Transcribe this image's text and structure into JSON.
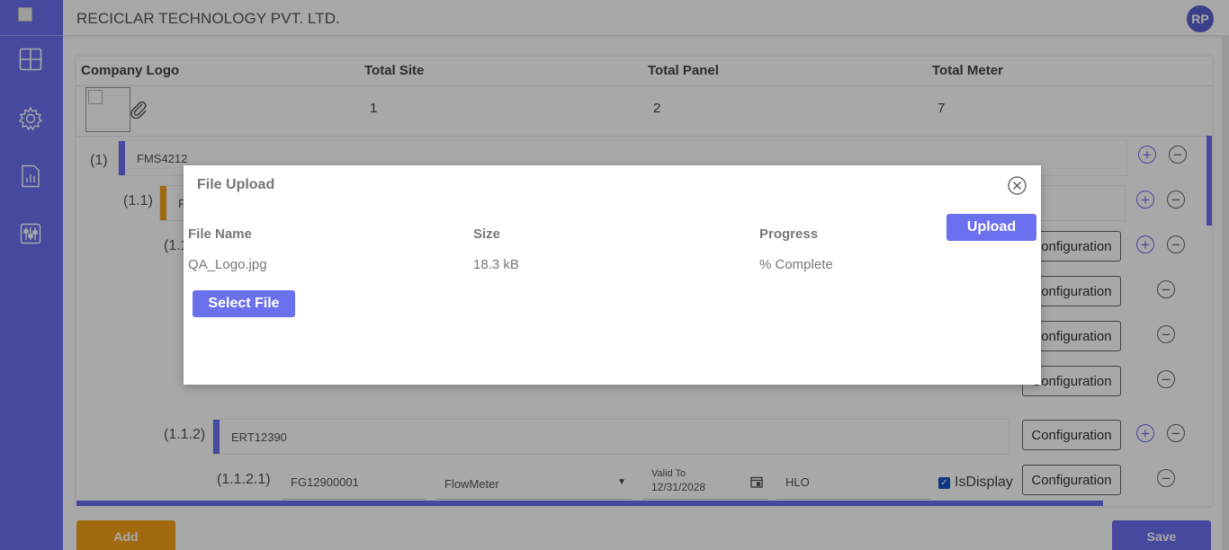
{
  "header": {
    "title": "RECICLAR TECHNOLOGY PVT. LTD.",
    "avatar_initials": "RP"
  },
  "sidebar": {
    "items": [
      {
        "icon": "dashboard-icon"
      },
      {
        "icon": "gear-icon"
      },
      {
        "icon": "report-icon"
      },
      {
        "icon": "sliders-icon"
      }
    ]
  },
  "summary": {
    "headers": [
      "Company Logo",
      "Total Site",
      "Total Panel",
      "Total Meter"
    ],
    "values": {
      "site": "1",
      "panel": "2",
      "meter": "7"
    }
  },
  "tree": {
    "site": {
      "level": "(1)",
      "name": "FMS4212"
    },
    "panel_level": "(1.1)",
    "panel_name_partial": "F",
    "meter_level_partial": "(1.1",
    "panel2": {
      "level": "(1.1.2)",
      "name": "ERT12390"
    },
    "meter_row": {
      "level": "(1.1.2.1)",
      "serial": "FG12900001",
      "type": "FlowMeter",
      "valid_label": "Valid To",
      "valid_date": "12/31/2028",
      "code": "HLO",
      "isdisplay_label": "IsDisplay"
    },
    "config_label": "Configuration"
  },
  "actions": {
    "add_label": "Add",
    "save_label": "Save"
  },
  "modal": {
    "title": "File Upload",
    "upload_label": "Upload",
    "select_label": "Select File",
    "columns": {
      "name": "File Name",
      "size": "Size",
      "progress": "Progress"
    },
    "file": {
      "name": "QA_Logo.jpg",
      "size": "18.3 kB",
      "progress": "% Complete"
    }
  },
  "colors": {
    "accent": "#6b70ee",
    "orange": "#f5a21b"
  }
}
